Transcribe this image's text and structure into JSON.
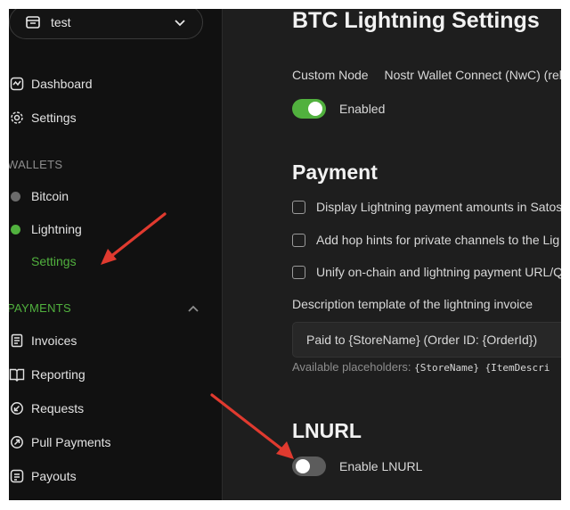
{
  "sidebar": {
    "store_name": "test",
    "items": [
      {
        "label": "Dashboard"
      },
      {
        "label": "Settings"
      }
    ],
    "wallets_label": "WALLETS",
    "wallets": [
      {
        "label": "Bitcoin",
        "status_color": "#6b6b6b"
      },
      {
        "label": "Lightning",
        "status_color": "#51b13e"
      }
    ],
    "lightning_sub": "Settings",
    "payments_label": "PAYMENTS",
    "payments": [
      {
        "label": "Invoices"
      },
      {
        "label": "Reporting"
      },
      {
        "label": "Requests"
      },
      {
        "label": "Pull Payments"
      },
      {
        "label": "Payouts"
      }
    ]
  },
  "main": {
    "title": "BTC Lightning Settings",
    "tabs": [
      "Custom Node",
      "Nostr Wallet Connect (NwC) (rela"
    ],
    "enabled_label": "Enabled",
    "payment_heading": "Payment",
    "checkboxes": [
      "Display Lightning payment amounts in Satos",
      "Add hop hints for private channels to the Lig",
      "Unify on-chain and lightning payment URL/Q"
    ],
    "description_label": "Description template of the lightning invoice",
    "description_value": "Paid to {StoreName} (Order ID: {OrderId})",
    "placeholders_label": "Available placeholders:",
    "placeholders_codes": "{StoreName} {ItemDescri",
    "lnurl_heading": "LNURL",
    "lnurl_toggle_label": "Enable LNURL"
  },
  "colors": {
    "accent": "#51b13e",
    "annotation_arrow": "#e03a2f"
  }
}
